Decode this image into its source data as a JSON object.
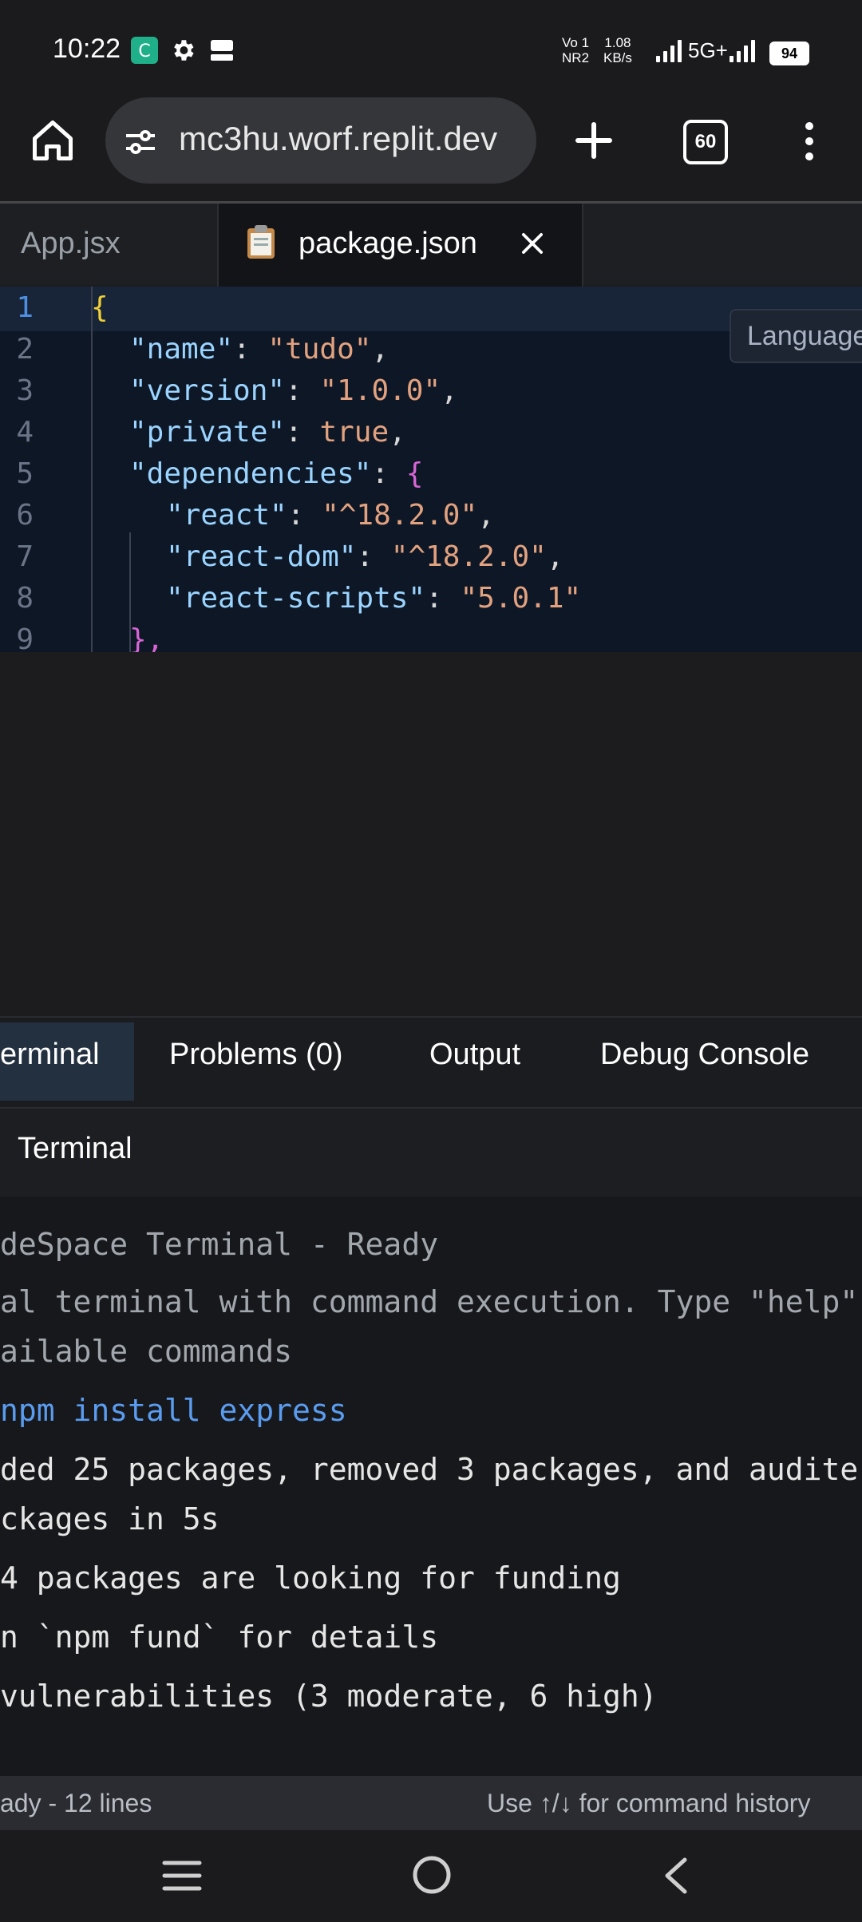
{
  "status_bar": {
    "time": "10:22",
    "volte": "Vo 1",
    "nr": "NR2",
    "speed_value": "1.08",
    "speed_unit": "KB/s",
    "network": "5G+",
    "battery": "94"
  },
  "browser": {
    "url": "mc3hu.worf.replit.dev",
    "tab_count": "60"
  },
  "editor": {
    "tabs": [
      {
        "label": "App.jsx"
      },
      {
        "label": "package.json"
      }
    ],
    "tooltip": "Language",
    "lines": [
      {
        "n": "1"
      },
      {
        "n": "2"
      },
      {
        "n": "3"
      },
      {
        "n": "4"
      },
      {
        "n": "5"
      },
      {
        "n": "6"
      },
      {
        "n": "7"
      },
      {
        "n": "8"
      },
      {
        "n": "9"
      }
    ],
    "code": {
      "l1": "{",
      "l2k": "\"name\"",
      "l2v": "\"tudo\"",
      "l3k": "\"version\"",
      "l3v": "\"1.0.0\"",
      "l4k": "\"private\"",
      "l4v": "true",
      "l5k": "\"dependencies\"",
      "l5v": "{",
      "l6k": "\"react\"",
      "l6v": "\"^18.2.0\"",
      "l7k": "\"react-dom\"",
      "l7v": "\"^18.2.0\"",
      "l8k": "\"react-scripts\"",
      "l8v": "\"5.0.1\"",
      "l9": "},"
    }
  },
  "panel": {
    "tabs": [
      "erminal",
      "Problems (0)",
      "Output",
      "Debug Console"
    ],
    "header": "Terminal"
  },
  "terminal": {
    "lines": [
      "deSpace Terminal - Ready",
      "al terminal with command execution. Type \"help\"",
      "ailable commands",
      "npm install express",
      "ded 25 packages, removed 3 packages, and audite",
      "ckages in 5s",
      "4 packages are looking for funding",
      "n `npm fund` for details",
      "vulnerabilities (3 moderate, 6 high)"
    ],
    "footer_left": "ady - 12 lines",
    "footer_right": "Use ↑/↓ for command history"
  },
  "icons": {
    "home": "home-icon",
    "site_settings": "tune-icon",
    "new_tab": "plus-icon",
    "menu": "more-vert-icon",
    "close": "close-icon",
    "file": "clipboard-icon"
  }
}
